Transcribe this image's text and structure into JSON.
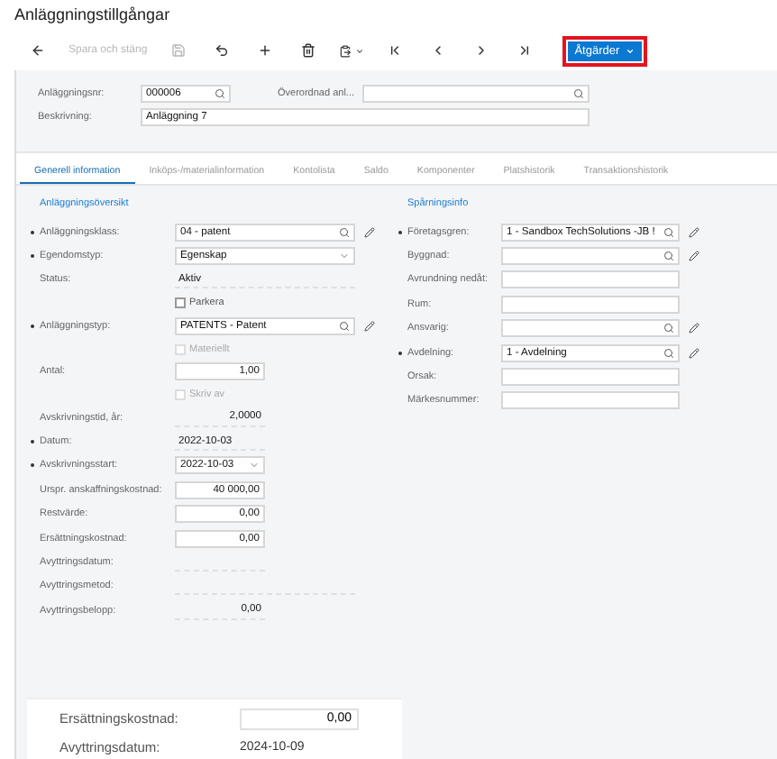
{
  "title": "Anläggningstillgångar",
  "toolbar": {
    "save_close": {
      "label": "Spara och stäng",
      "disabled": true
    },
    "actions": {
      "label": "Åtgärder",
      "highlighted": true
    }
  },
  "header": {
    "fields": [
      {
        "label": "Anläggningsnr:",
        "kind": "lookup_short",
        "value": "000006"
      },
      {
        "label": "Överordnad anl...",
        "kind": "lookup"
      },
      {
        "label": "Beskrivning:",
        "kind": "text",
        "value": "Anläggning 7"
      }
    ]
  },
  "tabs": [
    {
      "label": "Generell information",
      "selected": true
    },
    {
      "label": "Inköps-/materialinformation",
      "selected": false
    },
    {
      "label": "Kontolista",
      "selected": false
    },
    {
      "label": "Saldo",
      "selected": false
    },
    {
      "label": "Komponenter",
      "selected": false
    },
    {
      "label": "Platshistorik",
      "selected": false
    },
    {
      "label": "Transaktionshistorik",
      "selected": false
    }
  ],
  "sections": [
    {
      "title": "Anläggningsöversikt",
      "rows": [
        {
          "kind": "lookup",
          "label": "Anläggningsklass:",
          "value": "04 - patent",
          "required": true,
          "editable": true
        },
        {
          "kind": "select",
          "label": "Egendomstyp:",
          "value": "Egenskap",
          "required": true
        },
        {
          "kind": "display",
          "label": "Status:",
          "value": "Aktiv",
          "required": false
        },
        {
          "kind": "checkbox",
          "label": "Parkera",
          "checked": false,
          "disabled": false
        },
        {
          "kind": "lookup",
          "label": "Anläggningstyp:",
          "value": "PATENTS - Patent",
          "required": true,
          "editable": true
        },
        {
          "kind": "checkbox",
          "label": "Materiellt",
          "checked": false,
          "disabled": true
        },
        {
          "kind": "number",
          "label": "Antal:",
          "value": "1,00",
          "required": false
        },
        {
          "kind": "checkbox",
          "label": "Skriv av",
          "checked": false,
          "disabled": true
        },
        {
          "kind": "display_number",
          "label": "Avskrivningstid, år:",
          "value": "2,0000",
          "required": false
        },
        {
          "kind": "display_date",
          "label": "Datum:",
          "value": "2022-10-03",
          "required": true
        },
        {
          "kind": "date",
          "label": "Avskrivningsstart:",
          "value": "2022-10-03",
          "required": true
        },
        {
          "kind": "number",
          "label": "Urspr. anskaffningskostnad:",
          "value": "40 000,00",
          "required": false
        },
        {
          "kind": "number",
          "label": "Restvärde:",
          "value": "0,00",
          "required": false
        },
        {
          "kind": "number",
          "label": "Ersättningskostnad:",
          "value": "0,00",
          "required": false
        },
        {
          "kind": "display_number",
          "label": "Avyttringsdatum:",
          "required": false
        },
        {
          "kind": "display",
          "label": "Avyttringsmetod:",
          "required": false
        },
        {
          "kind": "display_number",
          "label": "Avyttringsbelopp:",
          "value": "0,00",
          "required": false
        }
      ]
    },
    {
      "title": "Spårningsinfo",
      "rows": [
        {
          "kind": "lookup",
          "label": "Företagsgren:",
          "value": "1 - Sandbox TechSolutions -JB !",
          "required": true,
          "editable": true
        },
        {
          "kind": "lookup",
          "label": "Byggnad:",
          "required": false,
          "editable": true
        },
        {
          "kind": "text",
          "label": "Avrundning nedåt:",
          "required": false
        },
        {
          "kind": "text",
          "label": "Rum:",
          "required": false
        },
        {
          "kind": "lookup",
          "label": "Ansvarig:",
          "required": false,
          "editable": true
        },
        {
          "kind": "lookup",
          "label": "Avdelning:",
          "value": "1 - Avdelning",
          "required": true,
          "editable": true
        },
        {
          "kind": "text",
          "label": "Orsak:",
          "required": false
        },
        {
          "kind": "text",
          "label": "Märkesnummer:",
          "required": false
        }
      ]
    }
  ],
  "zoomed_fragment": {
    "rows": [
      {
        "kind": "number",
        "label": "Ersättningskostnad:",
        "value": "0,00"
      },
      {
        "kind": "display",
        "label": "Avyttringsdatum:",
        "value": "2024-10-09"
      }
    ]
  }
}
